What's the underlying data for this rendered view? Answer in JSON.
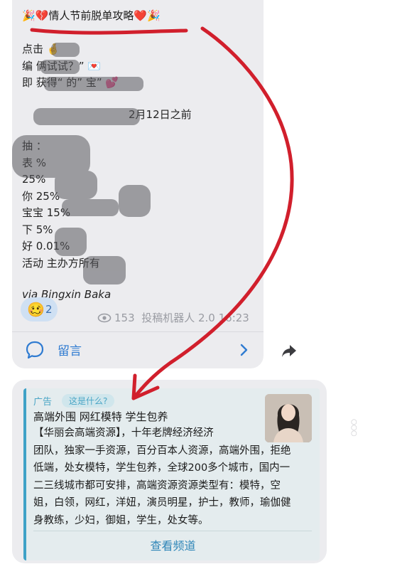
{
  "message": {
    "title_prefix": "🎉💔",
    "title_text": "情人节前脱单攻略",
    "title_suffix": "❤️🎉",
    "lines": [
      "点击 🤞",
      "编  俩试试？” 💌",
      "即  获得“  的”  宝” 💕"
    ],
    "date_line": "2月12日之前",
    "odds": [
      "抽 ：",
      "表 %",
      "  25%",
      "你  25%",
      "宝宝  15%",
      "下 5%",
      "好 0.01%",
      "活动  主办方所有"
    ],
    "via": "via Bingxin Baka",
    "reaction": {
      "emoji": "🥴",
      "count": "2"
    },
    "meta": {
      "views": "153",
      "author": "投稿机器人",
      "time": "2.0 16:23"
    },
    "comment_label": "留言"
  },
  "ad": {
    "label": "广告",
    "what_label": "这是什么?",
    "title": "高端外围 网红模特 学生包养",
    "body_lines": [
      "【华丽会高端资源】，十年老牌经济经济",
      "团队，独家一手资源，百分百本人资源，高端外围，拒绝",
      "低端，处女模特，学生包养，全球200多个城市，国内一",
      "二三线城市都可安排，高端资源资源类型有：模特，空",
      "姐，白领，网红，洋妞，演员明星，护士，教师，瑜伽健",
      "身教练，少妇，御姐，学生，处女等。"
    ],
    "button_label": "查看频道"
  },
  "colors": {
    "accent": "#2f7bd1",
    "ad_accent": "#3fa2c7",
    "annotation": "#d11f2c",
    "bubble": "#ececef"
  }
}
